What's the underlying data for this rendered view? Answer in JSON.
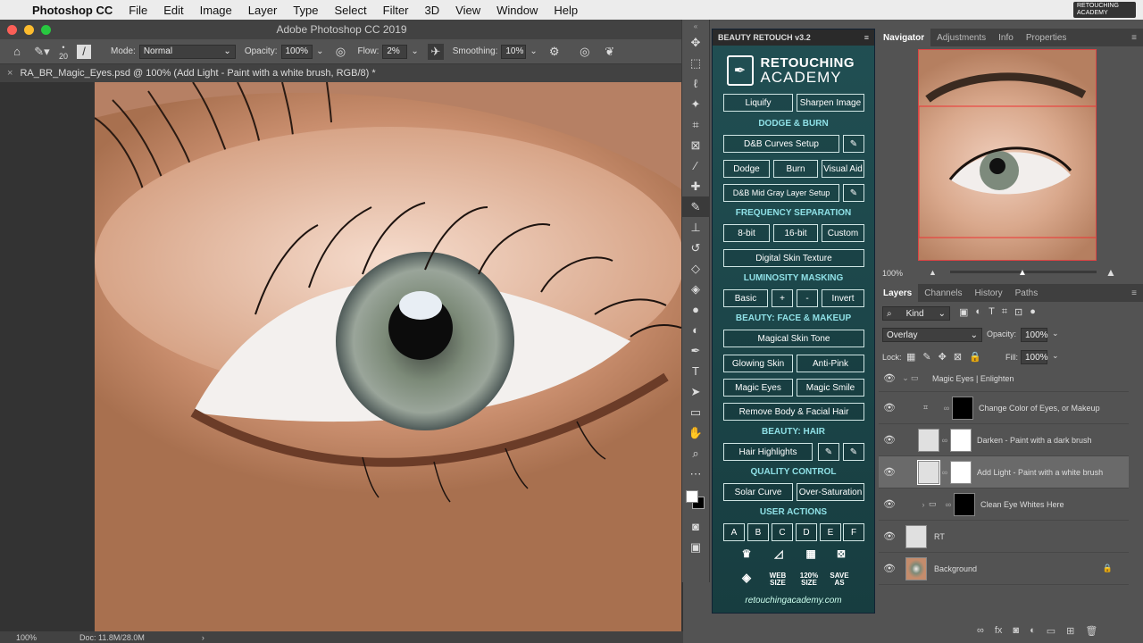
{
  "menubar": {
    "app": "Photoshop CC",
    "items": [
      "File",
      "Edit",
      "Image",
      "Layer",
      "Type",
      "Select",
      "Filter",
      "3D",
      "View",
      "Window",
      "Help"
    ],
    "logo_text": "RETOUCHING ACADEMY"
  },
  "window_title": "Adobe Photoshop CC 2019",
  "options": {
    "brush_size": "20",
    "mode_label": "Mode:",
    "mode_value": "Normal",
    "opacity_label": "Opacity:",
    "opacity_value": "100%",
    "flow_label": "Flow:",
    "flow_value": "2%",
    "smoothing_label": "Smoothing:",
    "smoothing_value": "10%"
  },
  "doc_tab": "RA_BR_Magic_Eyes.psd @ 100% (Add Light - Paint with a white brush, RGB/8) *",
  "status": {
    "zoom": "100%",
    "doc": "Doc: 11.8M/28.0M"
  },
  "br": {
    "header": "BEAUTY RETOUCH v3.2",
    "logo_line1": "RETOUCHING",
    "logo_line2": "ACADEMY",
    "liquify": "Liquify",
    "sharpen": "Sharpen Image",
    "sec_dodge": "DODGE & BURN",
    "db_curves": "D&B Curves Setup",
    "dodge": "Dodge",
    "burn": "Burn",
    "visual_aid": "Visual Aid",
    "db_midgray": "D&B Mid Gray Layer Setup",
    "sec_freq": "FREQUENCY SEPARATION",
    "bit8": "8-bit",
    "bit16": "16-bit",
    "custom": "Custom",
    "digital_skin": "Digital Skin Texture",
    "sec_lum": "LUMINOSITY MASKING",
    "basic": "Basic",
    "plus": "+",
    "minus": "-",
    "invert": "Invert",
    "sec_face": "BEAUTY: FACE & MAKEUP",
    "magical_skin": "Magical Skin Tone",
    "glowing_skin": "Glowing Skin",
    "anti_pink": "Anti-Pink",
    "magic_eyes": "Magic Eyes",
    "magic_smile": "Magic Smile",
    "remove_hair": "Remove Body & Facial Hair",
    "sec_hair": "BEAUTY: HAIR",
    "hair_highlights": "Hair Highlights",
    "sec_qc": "QUALITY CONTROL",
    "solar_curve": "Solar Curve",
    "over_saturation": "Over-Saturation",
    "sec_user": "USER ACTIONS",
    "user_actions": [
      "A",
      "B",
      "C",
      "D",
      "E",
      "F"
    ],
    "web_size": "WEB SIZE",
    "size120": "120% SIZE",
    "save_as": "SAVE AS",
    "footer": "retouchingacademy.com"
  },
  "nav": {
    "tabs": [
      "Navigator",
      "Adjustments",
      "Info",
      "Properties"
    ],
    "zoom": "100%"
  },
  "layers": {
    "tabs": [
      "Layers",
      "Channels",
      "History",
      "Paths"
    ],
    "filter_kind": "Kind",
    "blend_mode": "Overlay",
    "opacity_label": "Opacity:",
    "opacity_value": "100%",
    "lock_label": "Lock:",
    "fill_label": "Fill:",
    "fill_value": "100%",
    "rows": [
      {
        "name": "Magic Eyes | Enlighten"
      },
      {
        "name": "Change Color of Eyes, or Makeup"
      },
      {
        "name": "Darken - Paint with a dark brush"
      },
      {
        "name": "Add Light - Paint with a white brush"
      },
      {
        "name": "Clean Eye Whites Here"
      },
      {
        "name": "RT"
      },
      {
        "name": "Background"
      }
    ]
  }
}
